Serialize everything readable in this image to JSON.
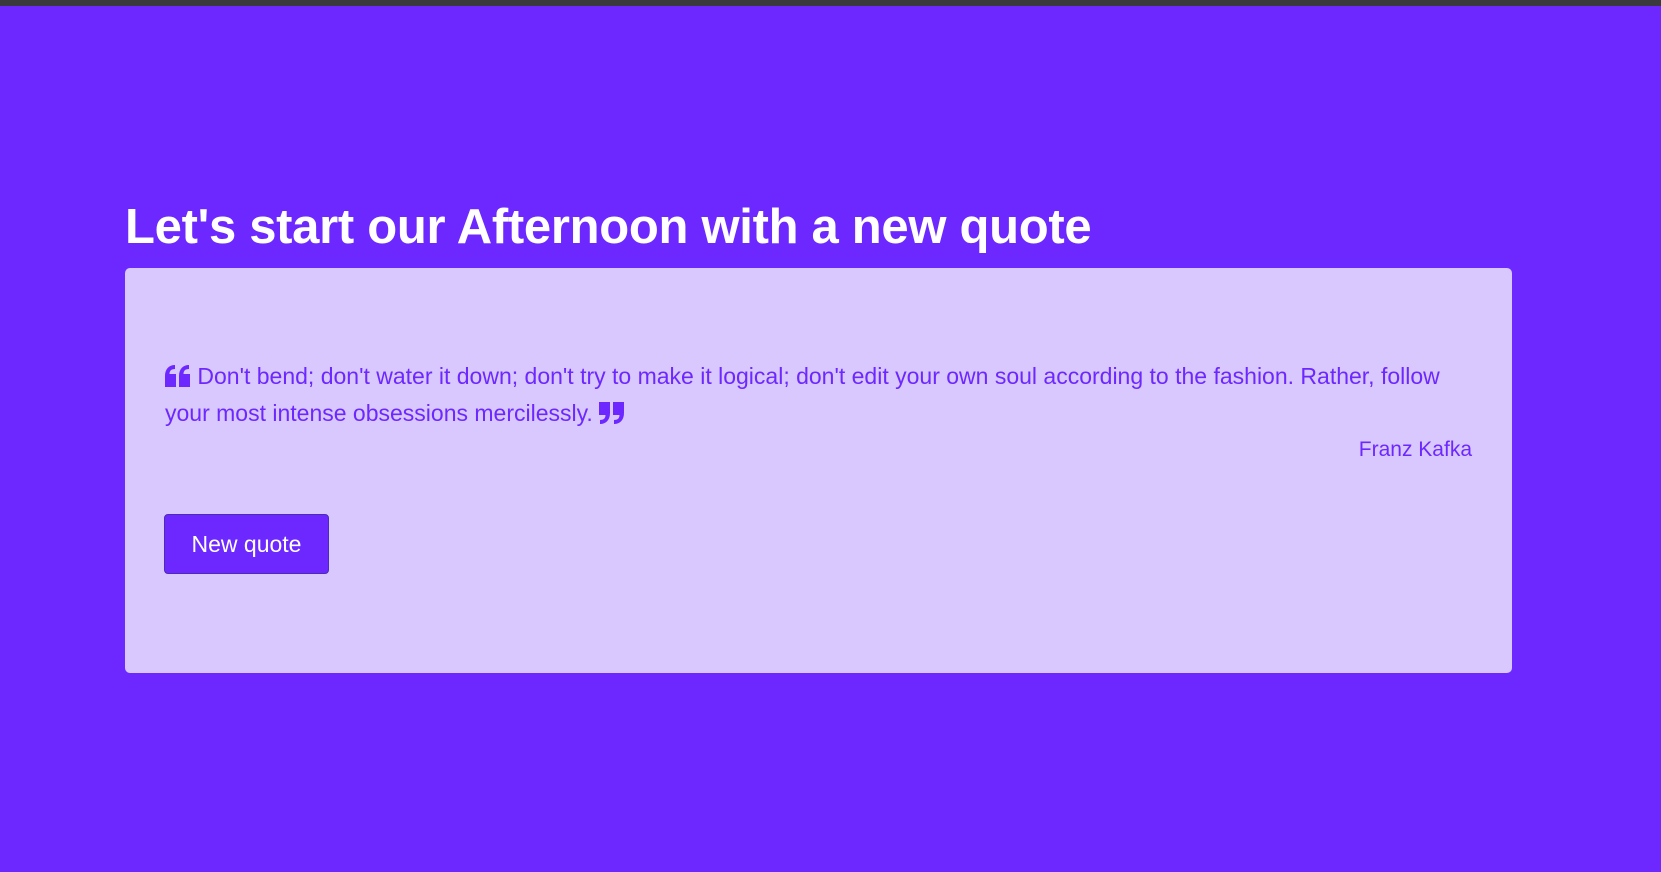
{
  "header": {
    "title": "Let's start our Afternoon with a new quote"
  },
  "quote": {
    "text": "Don't bend; don't water it down; don't try to make it logical; don't edit your own soul according to the fashion. Rather, follow your most intense obsessions mercilessly.",
    "author": "Franz Kafka",
    "open_icon": "quote-left-icon",
    "close_icon": "quote-right-icon"
  },
  "actions": {
    "new_quote_label": "New quote"
  },
  "colors": {
    "background": "#6d28ff",
    "card": "#d8c8fd",
    "accent": "#6d28ff",
    "title_text": "#ffffff"
  }
}
